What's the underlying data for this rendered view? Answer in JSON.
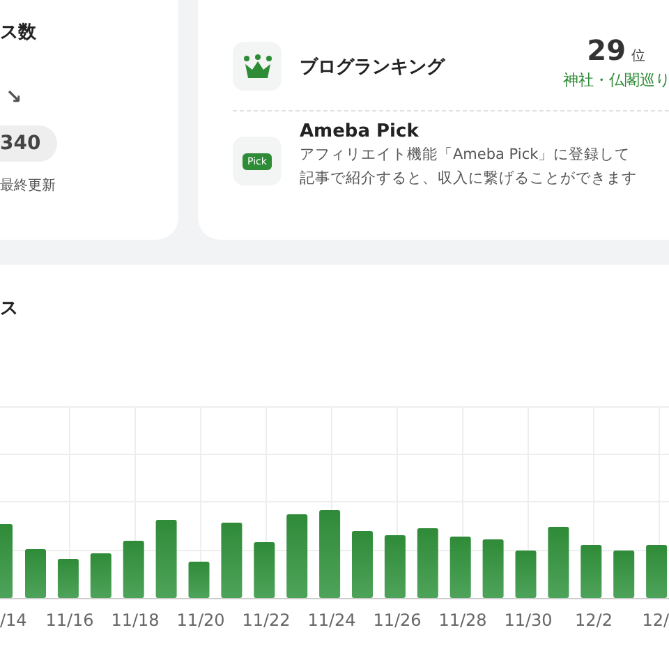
{
  "access_card": {
    "title": "ス数",
    "trend": "↘",
    "count": "340",
    "updated": "最終更新"
  },
  "ranking": {
    "label": "ブログランキング",
    "rank": "29",
    "unit": "位",
    "category": "神社・仏閣巡り"
  },
  "ameba_pick": {
    "badge": "Pick",
    "title": "Ameba Pick",
    "lines": [
      "アフィリエイト機能「Ameba Pick」に登録して",
      "記事で紹介すると、収入に繋げることができます"
    ]
  },
  "chart_section": {
    "title": "ス",
    "x_labels": [
      "/14",
      "11/16",
      "11/18",
      "11/20",
      "11/22",
      "11/24",
      "11/26",
      "11/28",
      "11/30",
      "12/2",
      "12/"
    ]
  }
}
